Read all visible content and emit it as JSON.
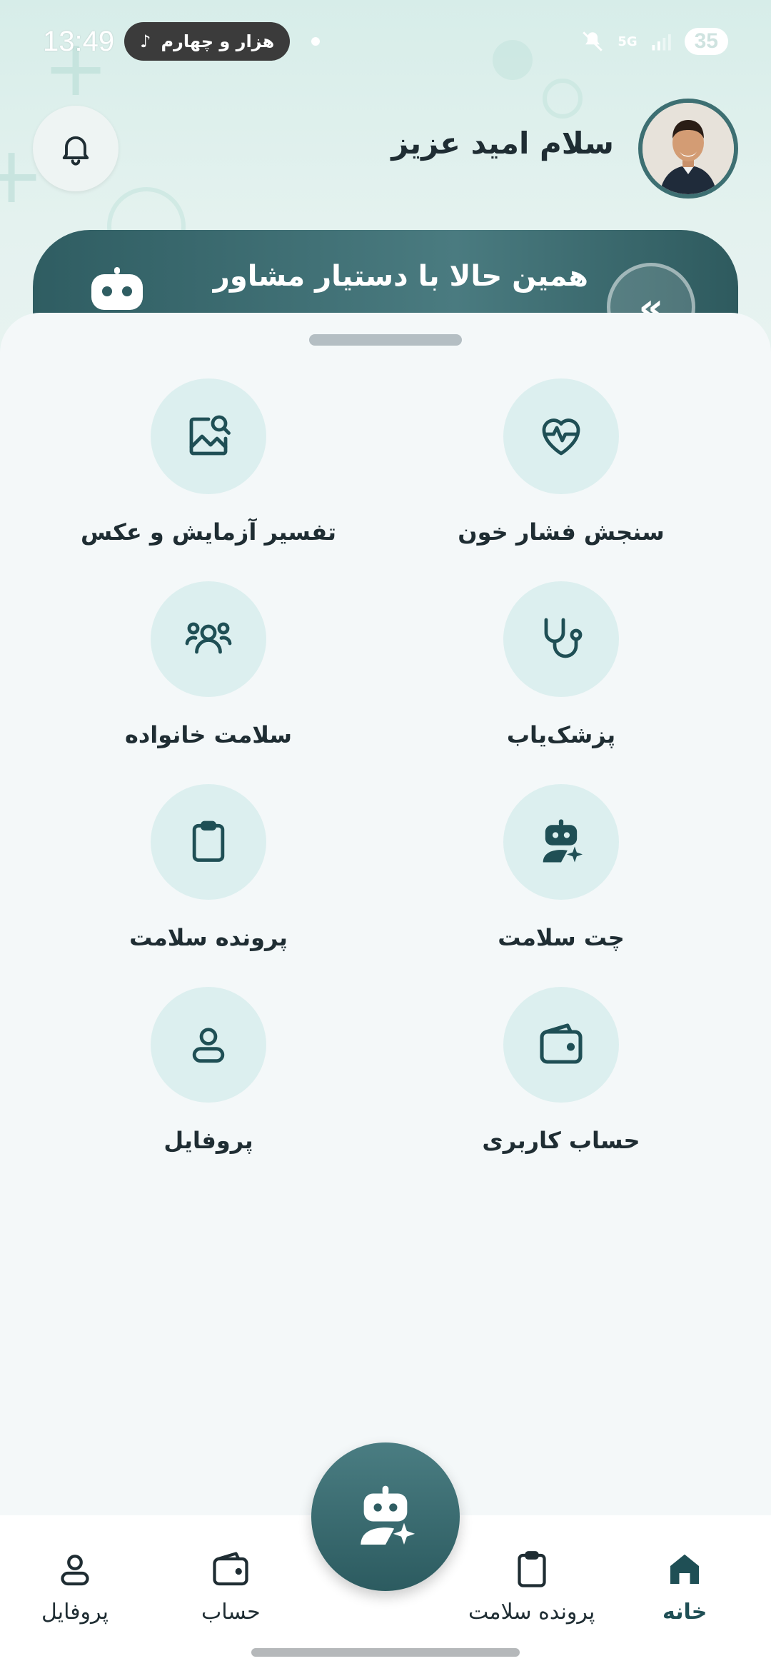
{
  "status_bar": {
    "time": "13:49",
    "music_title": "هزار و چهارم",
    "battery": "35",
    "network": "5G"
  },
  "header": {
    "greeting": "سلام امید عزیز",
    "banner_text": "همین حالا با دستیار مشاور"
  },
  "tiles": [
    {
      "label": "سنجش فشار خون",
      "icon": "heart-pulse-icon"
    },
    {
      "label": "تفسیر آزمایش و عکس",
      "icon": "image-search-icon"
    },
    {
      "label": "پزشک‌یاب",
      "icon": "stethoscope-icon"
    },
    {
      "label": "سلامت خانواده",
      "icon": "family-icon"
    },
    {
      "label": "چت سلامت",
      "icon": "ai-robot-icon"
    },
    {
      "label": "پرونده سلامت",
      "icon": "clipboard-icon"
    },
    {
      "label": "حساب کاربری",
      "icon": "wallet-icon"
    },
    {
      "label": "پروفایل",
      "icon": "user-icon"
    }
  ],
  "nav": {
    "home": "خانه",
    "health_record": "پرونده سلامت",
    "account": "حساب",
    "profile": "پروفایل"
  },
  "colors": {
    "primary": "#2f5d62",
    "tile_bg": "#dcefef",
    "sheet_bg": "#f4f8f9"
  }
}
